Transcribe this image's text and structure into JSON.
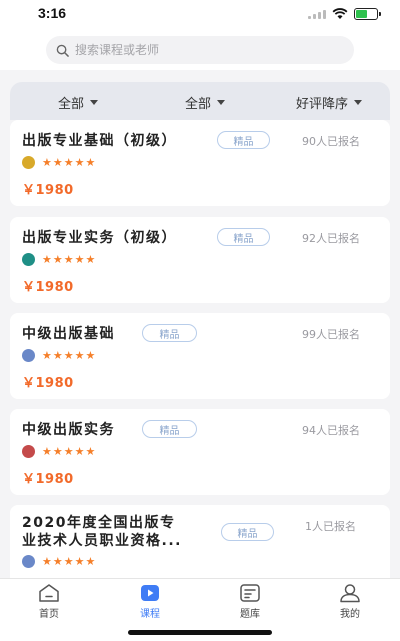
{
  "status": {
    "time": "3:16"
  },
  "search": {
    "placeholder": "搜索课程或老师"
  },
  "filters": [
    {
      "label": "全部"
    },
    {
      "label": "全部"
    },
    {
      "label": "好评降序"
    }
  ],
  "courses": [
    {
      "title": "出版专业基础（初级）",
      "tag": "精品",
      "enrolled": "90人已报名",
      "stars": "★★★★★",
      "rating": 5,
      "price": "￥1980",
      "avatar_color": "#d8a92a"
    },
    {
      "title": "出版专业实务（初级）",
      "tag": "精品",
      "enrolled": "92人已报名",
      "stars": "★★★★★",
      "rating": 5,
      "price": "￥1980",
      "avatar_color": "#1f8f86"
    },
    {
      "title": "中级出版基础",
      "tag": "精品",
      "enrolled": "99人已报名",
      "stars": "★★★★★",
      "rating": 5,
      "price": "￥1980",
      "avatar_color": "#6a88c8"
    },
    {
      "title": "中级出版实务",
      "tag": "精品",
      "enrolled": "94人已报名",
      "stars": "★★★★★",
      "rating": 5,
      "price": "￥1980",
      "avatar_color": "#c44a4a"
    },
    {
      "title_line1": "2020年度全国出版专",
      "title_line2": "业技术人员职业资格...",
      "tag": "精品",
      "enrolled": "1人已报名",
      "stars": "★★★★★",
      "rating": 5,
      "avatar_color": "#6a88c8"
    }
  ],
  "tabs": [
    {
      "label": "首页",
      "icon": "home-icon"
    },
    {
      "label": "课程",
      "icon": "course-play-icon",
      "active": true
    },
    {
      "label": "题库",
      "icon": "question-bank-icon"
    },
    {
      "label": "我的",
      "icon": "profile-icon"
    }
  ],
  "colors": {
    "accent": "#3f7cf5",
    "price": "#f26a2a",
    "star": "#f57f2a",
    "tag_border": "#b8cdea"
  }
}
